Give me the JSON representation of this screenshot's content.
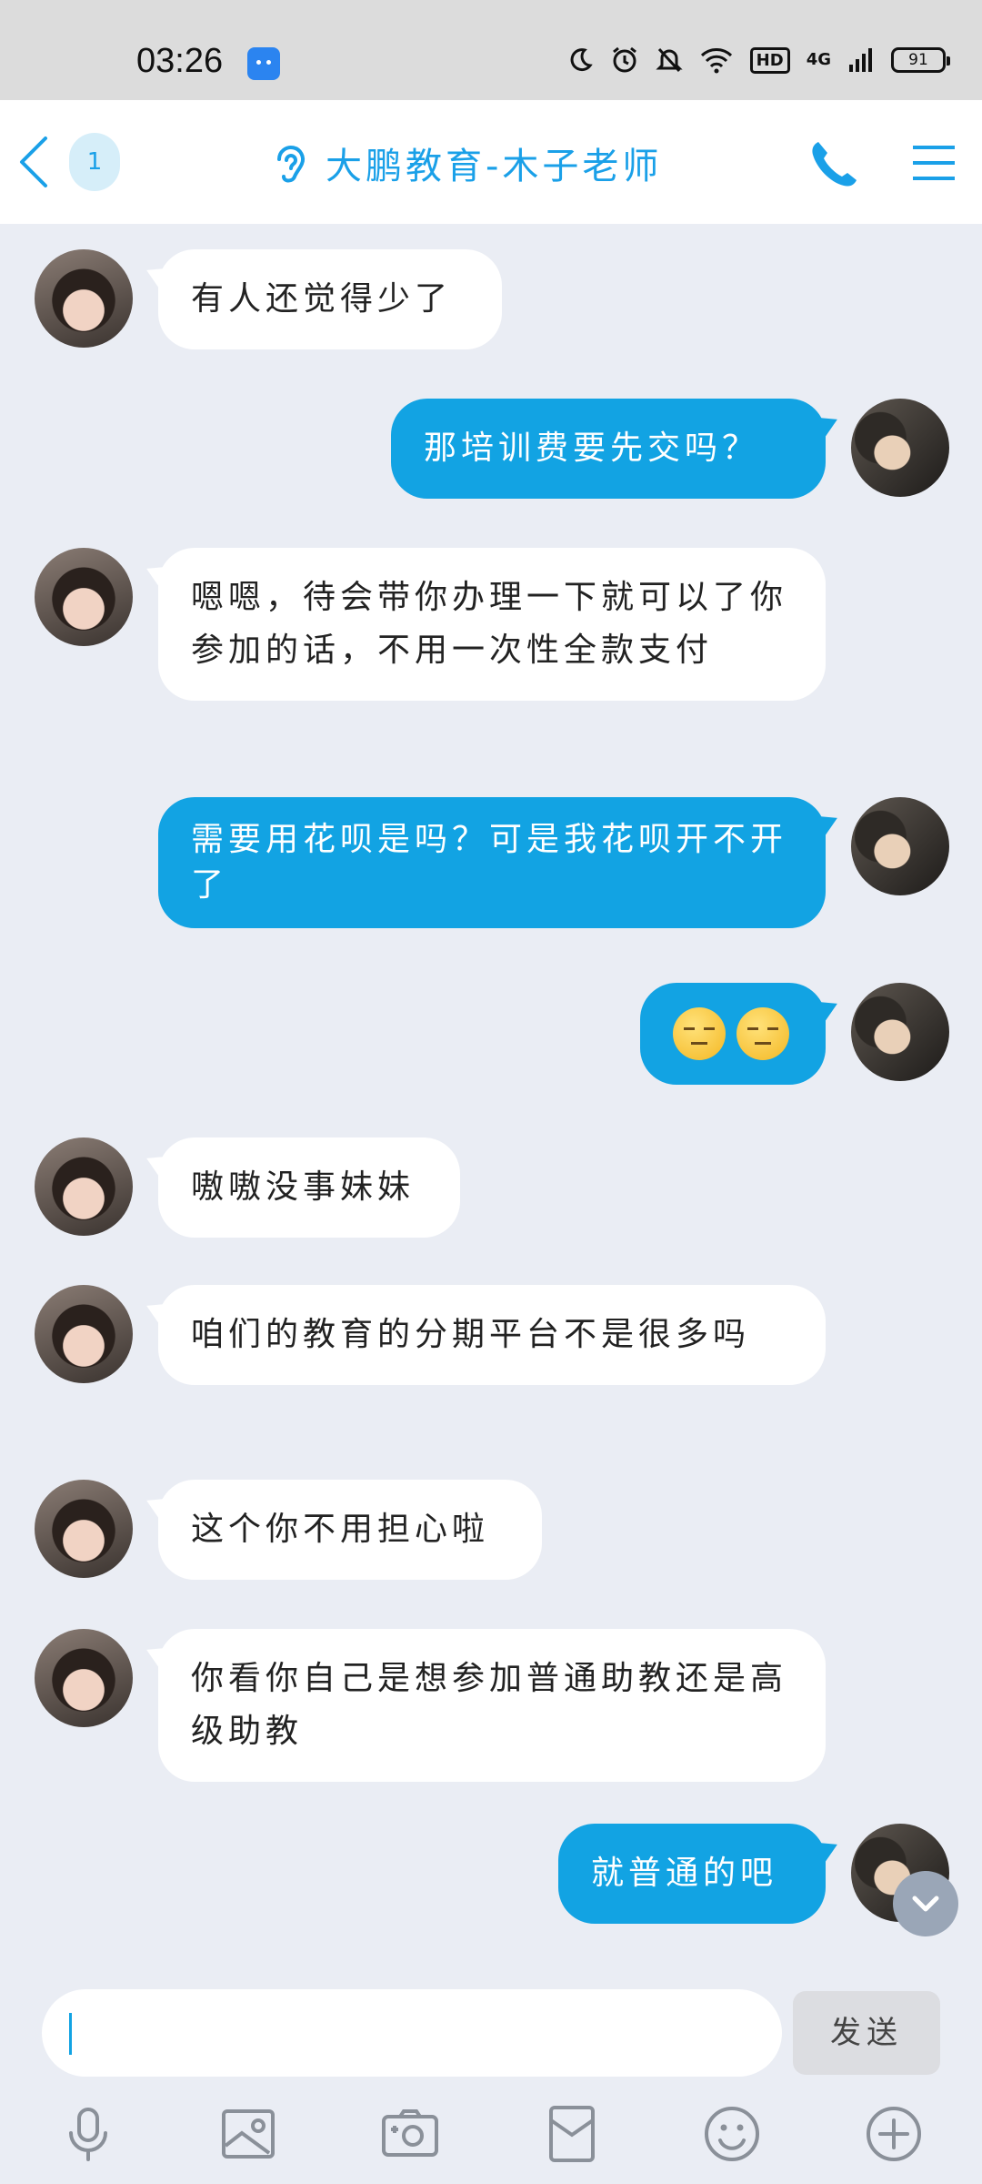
{
  "status_bar": {
    "time": "03:26",
    "network": "4G",
    "hd": "HD",
    "battery": "91"
  },
  "header": {
    "unread_count": "1",
    "title": "大鹏教育-木子老师"
  },
  "messages": [
    {
      "side": "in",
      "text": "有人还觉得少了"
    },
    {
      "side": "out",
      "text": "那培训费要先交吗？"
    },
    {
      "side": "in",
      "text": "嗯嗯，待会带你办理一下就可以了你参加的话，不用一次性全款支付"
    },
    {
      "side": "out",
      "text": "需要用花呗是吗？可是我花呗开不开了"
    },
    {
      "side": "out",
      "emoji": [
        "face-emoji",
        "face-emoji"
      ]
    },
    {
      "side": "in",
      "text": "嗷嗷没事妹妹"
    },
    {
      "side": "in",
      "text": "咱们的教育的分期平台不是很多吗"
    },
    {
      "side": "in",
      "text": "这个你不用担心啦"
    },
    {
      "side": "in",
      "text": "你看你自己是想参加普通助教还是高级助教"
    },
    {
      "side": "out",
      "text": "就普通的吧"
    }
  ],
  "composer": {
    "input_value": "",
    "send_label": "发送"
  },
  "toolbar": [
    "microphone-icon",
    "picture-icon",
    "camera-icon",
    "red-packet-icon",
    "smiley-icon",
    "plus-icon"
  ],
  "colors": {
    "accent": "#12a3e3",
    "title": "#1aa0e8",
    "background": "#eaedf4"
  }
}
